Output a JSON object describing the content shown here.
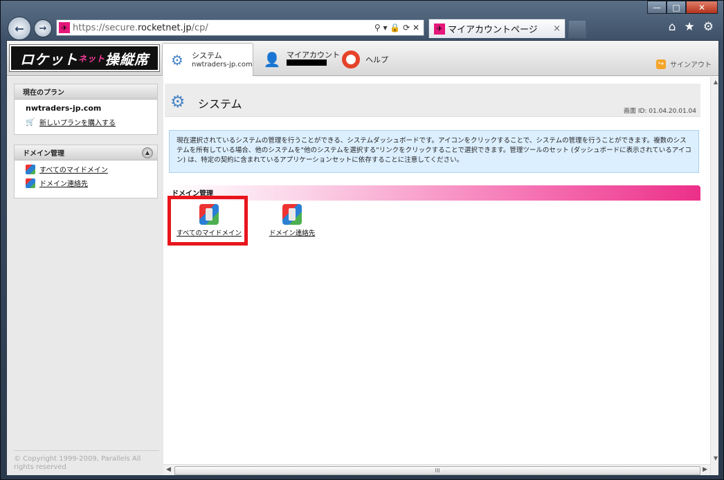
{
  "browser": {
    "url_prefix": "https://secure.",
    "url_host": "rocketnet.jp",
    "url_path": "/cp/",
    "tab_title": "マイアカウントページ",
    "tab_close": "×",
    "addr_icons": "⚲ ▾ 🔒 ⟳ ✕",
    "tools": {
      "home": "⌂",
      "favorites": "★",
      "settings": "⚙"
    },
    "window_controls": {
      "minimize": "—",
      "maximize": "□",
      "close": "✕"
    }
  },
  "header": {
    "logo_text": "ロケット",
    "logo_accent": "ネット",
    "logo_suffix": "操縦席",
    "tabs": [
      {
        "label": "システム",
        "sub": "nwtraders-jp.com"
      },
      {
        "label": "マイアカウント",
        "sub": ""
      },
      {
        "label": "ヘルプ",
        "sub": ""
      }
    ],
    "signout": "サインアウト"
  },
  "sidebar": {
    "plan_heading": "現在のプラン",
    "plan_domain": "nwtraders-jp.com",
    "buy_plan": "新しいプランを購入する",
    "domain_heading": "ドメイン管理",
    "domain_items": [
      "すべてのマイドメイン",
      "ドメイン連絡先"
    ],
    "copyright": "© Copyright 1999-2009, Parallels All rights reserved"
  },
  "content": {
    "title": "システム",
    "screen_id": "画面 ID: 01.04.20.01.04",
    "info": "現在選択されているシステムの管理を行うことができる、システムダッシュボードです。アイコンをクリックすることで、システムの管理を行うことができます。複数のシステムを所有している場合、他のシステムを\"他のシステムを選択する\"リンクをクリックすることで選択できます。管理ツールのセット (ダッシュボードに表示されているアイコン) は、特定の契約に含まれているアプリケーションセットに依存することに注意してください。",
    "section_title": "ドメイン管理",
    "grid_items": [
      "すべてのマイドメイン",
      "ドメイン連絡先"
    ]
  },
  "colors": {
    "highlight": "#e8151c",
    "section_pink": "#ec2f89",
    "info_bg": "#dcefff"
  }
}
